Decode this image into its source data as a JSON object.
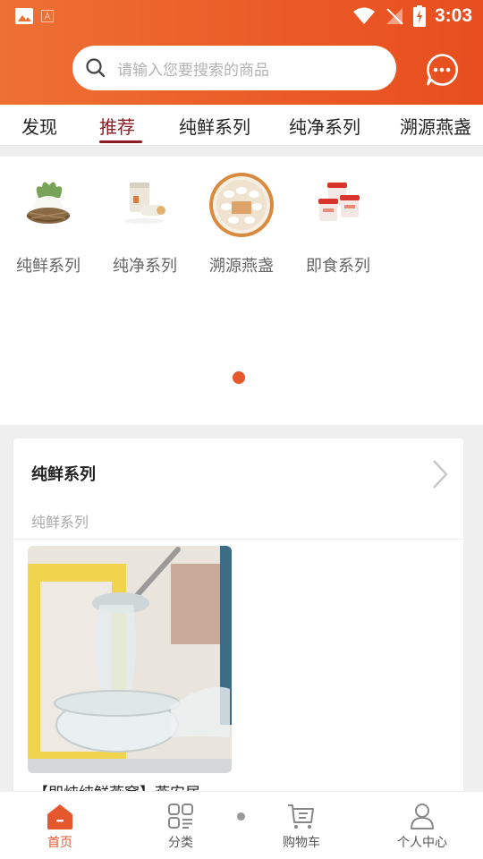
{
  "status_bar": {
    "time": "3:03"
  },
  "search": {
    "placeholder": "请输入您要搜索的商品"
  },
  "tabs": [
    {
      "label": "发现"
    },
    {
      "label": "推荐"
    },
    {
      "label": "纯鲜系列"
    },
    {
      "label": "纯净系列"
    },
    {
      "label": "溯源燕盏"
    }
  ],
  "active_tab": "推荐",
  "categories": [
    {
      "label": "纯鲜系列",
      "icon": "bird-nest-image"
    },
    {
      "label": "纯净系列",
      "icon": "jar-image"
    },
    {
      "label": "溯源燕盏",
      "icon": "gift-box-image"
    },
    {
      "label": "即食系列",
      "icon": "bottles-image"
    }
  ],
  "section": {
    "title": "纯鲜系列",
    "subtitle": "纯鲜系列",
    "product_name": "【即炖纯鲜燕窝】燕安居"
  },
  "bottom_nav": [
    {
      "label": "首页",
      "icon": "home-icon"
    },
    {
      "label": "分类",
      "icon": "category-icon"
    },
    {
      "label": "购物车",
      "icon": "cart-icon"
    },
    {
      "label": "个人中心",
      "icon": "user-icon"
    }
  ],
  "colors": {
    "brand": "#e5582d",
    "active_tab": "#8b1c22"
  }
}
